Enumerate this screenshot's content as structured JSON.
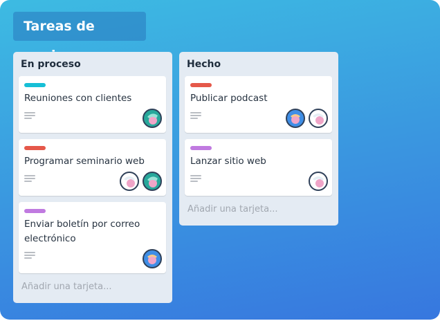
{
  "board": {
    "title": "Tareas de equipo"
  },
  "colors": {
    "cyan": "#16bfd6",
    "red": "#e5584a",
    "purple": "#c07ae0"
  },
  "lists": [
    {
      "title": "En proceso",
      "add_card_label": "Añadir una tarjeta...",
      "cards": [
        {
          "title": "Reuniones con clientes",
          "label_color": "cyan",
          "avatars": [
            "teal-avatar"
          ]
        },
        {
          "title": "Programar seminario web",
          "label_color": "red",
          "avatars": [
            "white-avatar",
            "teal-avatar"
          ]
        },
        {
          "title": "Enviar boletín por correo electrónico",
          "label_color": "purple",
          "avatars": [
            "blue-avatar"
          ]
        }
      ]
    },
    {
      "title": "Hecho",
      "add_card_label": "Añadir una tarjeta...",
      "cards": [
        {
          "title": "Publicar podcast",
          "label_color": "red",
          "avatars": [
            "blue-avatar",
            "white-avatar"
          ]
        },
        {
          "title": "Lanzar sitio web",
          "label_color": "purple",
          "avatars": [
            "white-avatar"
          ]
        }
      ]
    }
  ]
}
